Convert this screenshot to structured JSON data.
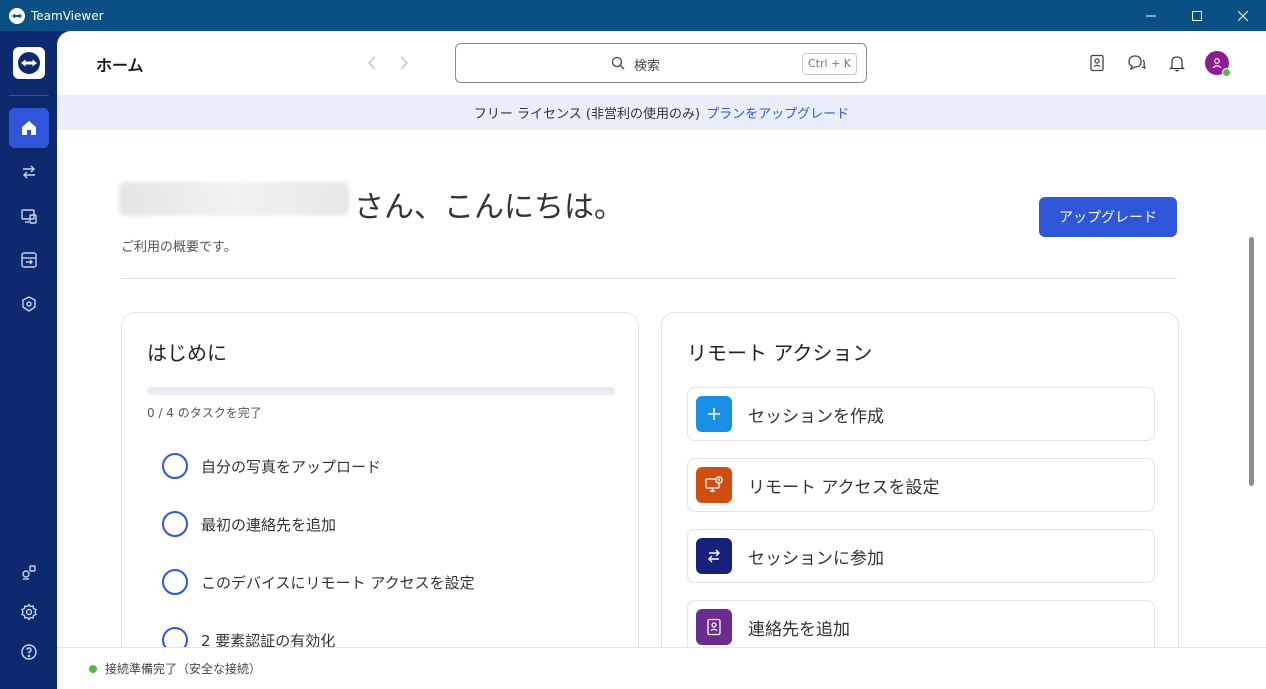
{
  "window": {
    "title": "TeamViewer"
  },
  "colors": {
    "accent": "#2f56d8",
    "sidebar": "#0e2a6e",
    "titlebar": "#0b5085",
    "online": "#56b84a"
  },
  "nav": {
    "items": [
      {
        "name": "home",
        "icon": "home-icon",
        "active": true
      },
      {
        "name": "remote-connect",
        "icon": "swap-arrows-icon",
        "active": false
      },
      {
        "name": "devices",
        "icon": "devices-icon",
        "active": false
      },
      {
        "name": "sessions",
        "icon": "session-icon",
        "active": false
      },
      {
        "name": "security",
        "icon": "shield-icon",
        "active": false
      }
    ],
    "bottom": [
      {
        "name": "integrations",
        "icon": "integrations-icon"
      },
      {
        "name": "settings",
        "icon": "gear-icon"
      },
      {
        "name": "help",
        "icon": "help-icon"
      }
    ]
  },
  "header": {
    "title": "ホーム",
    "search_placeholder": "検索",
    "search_shortcut": "Ctrl + K"
  },
  "banner": {
    "text": "フリー ライセンス (非営利の使用のみ)",
    "link": "プランをアップグレード"
  },
  "greeting": {
    "text": "さん、こんにちは。",
    "subtitle": "ご利用の概要です。",
    "upgrade_button": "アップグレード"
  },
  "getting_started": {
    "title": "はじめに",
    "progress_text": "0 / 4 のタスクを完了",
    "progress": 0,
    "tasks": [
      "自分の写真をアップロード",
      "最初の連絡先を追加",
      "このデバイスにリモート アクセスを設定",
      "2 要素認証の有効化"
    ]
  },
  "remote_actions": {
    "title": "リモート アクション",
    "actions": [
      {
        "label": "セッションを作成",
        "icon": "plus-icon",
        "color": "#1a8fe8"
      },
      {
        "label": "リモート アクセスを設定",
        "icon": "remote-access-icon",
        "color": "#d04e10"
      },
      {
        "label": "セッションに参加",
        "icon": "swap-arrows-icon",
        "color": "#17207a"
      },
      {
        "label": "連絡先を追加",
        "icon": "contact-book-icon",
        "color": "#6b2c8f"
      }
    ]
  },
  "status": {
    "text": "接続準備完了（安全な接続）"
  }
}
